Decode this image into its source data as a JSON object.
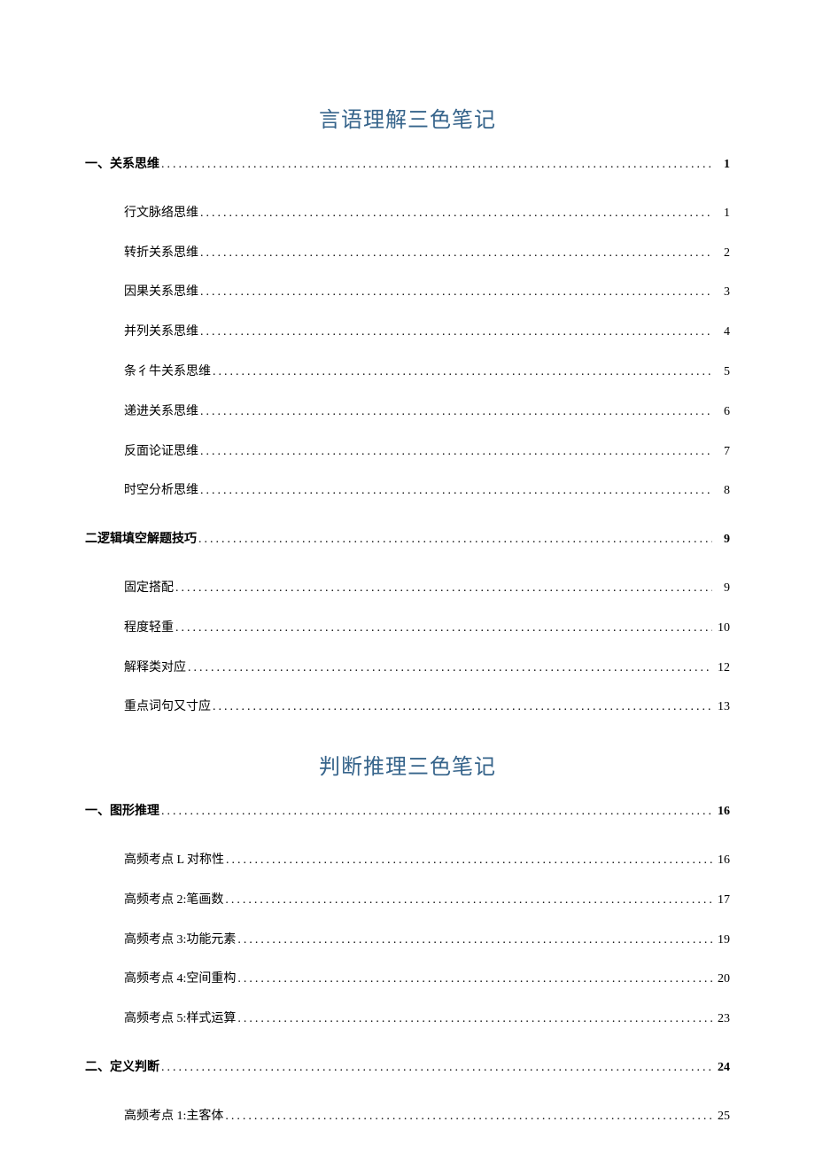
{
  "sections": [
    {
      "title": "言语理解三色笔记",
      "entries": [
        {
          "level": 1,
          "label": "一、关系思维",
          "page": "1"
        },
        {
          "level": 2,
          "label": "行文脉络思维",
          "page": "1"
        },
        {
          "level": 2,
          "label": "转折关系思维",
          "page": "2"
        },
        {
          "level": 2,
          "label": "因果关系思维",
          "page": "3"
        },
        {
          "level": 2,
          "label": "并列关系思维",
          "page": "4"
        },
        {
          "level": 2,
          "label": "条彳牛关系思维",
          "page": "5"
        },
        {
          "level": 2,
          "label": "递进关系思维",
          "page": "6"
        },
        {
          "level": 2,
          "label": "反面论证思维",
          "page": "7"
        },
        {
          "level": 2,
          "label": "时空分析思维",
          "page": "8",
          "lastInGroup": true
        },
        {
          "level": 1,
          "label": "二逻辑填空解题技巧",
          "page": "9"
        },
        {
          "level": 2,
          "label": "固定搭配",
          "page": "9"
        },
        {
          "level": 2,
          "label": "程度轻重",
          "page": "10"
        },
        {
          "level": 2,
          "label": "解释类对应",
          "page": "12"
        },
        {
          "level": 2,
          "label": "重点词句又寸应",
          "page": "13",
          "lastInGroup": true
        }
      ]
    },
    {
      "title": "判断推理三色笔记",
      "entries": [
        {
          "level": 1,
          "label": "一、图形推理",
          "page": "16"
        },
        {
          "level": 2,
          "label": "高频考点 L 对称性",
          "page": "16"
        },
        {
          "level": 2,
          "label": "高频考点 2:笔画数",
          "page": "17"
        },
        {
          "level": 2,
          "label": "高频考点 3:功能元素",
          "page": "19"
        },
        {
          "level": 2,
          "label": "高频考点 4:空间重构",
          "page": "20"
        },
        {
          "level": 2,
          "label": "高频考点 5:样式运算",
          "page": "23",
          "lastInGroup": true
        },
        {
          "level": 1,
          "label": "二、定义判断",
          "page": "24"
        },
        {
          "level": 2,
          "label": "高频考点 1:主客体",
          "page": "25"
        }
      ]
    }
  ]
}
